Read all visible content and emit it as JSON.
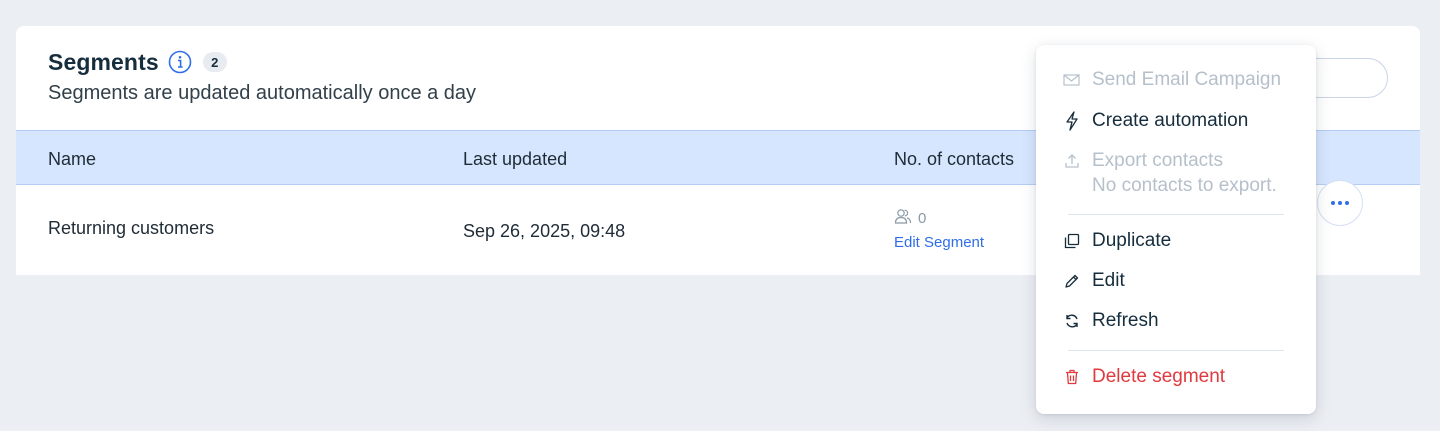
{
  "header": {
    "title": "Segments",
    "count": "2",
    "subtitle": "Segments are updated automatically once a day"
  },
  "table": {
    "columns": [
      "Name",
      "Last updated",
      "No. of contacts"
    ],
    "rows": [
      {
        "name": "Returning customers",
        "last_updated": "Sep 26, 2025, 09:48",
        "contacts": "0",
        "edit_label": "Edit Segment"
      }
    ]
  },
  "menu": {
    "send_email": "Send Email Campaign",
    "create_automation": "Create automation",
    "export_contacts": "Export contacts",
    "export_note": "No contacts to export.",
    "duplicate": "Duplicate",
    "edit": "Edit",
    "refresh": "Refresh",
    "delete": "Delete segment"
  },
  "colors": {
    "accent": "#2f6ee8",
    "header_bg": "#d6e6fe",
    "danger": "#e0393e",
    "disabled": "#b6c0cb"
  }
}
